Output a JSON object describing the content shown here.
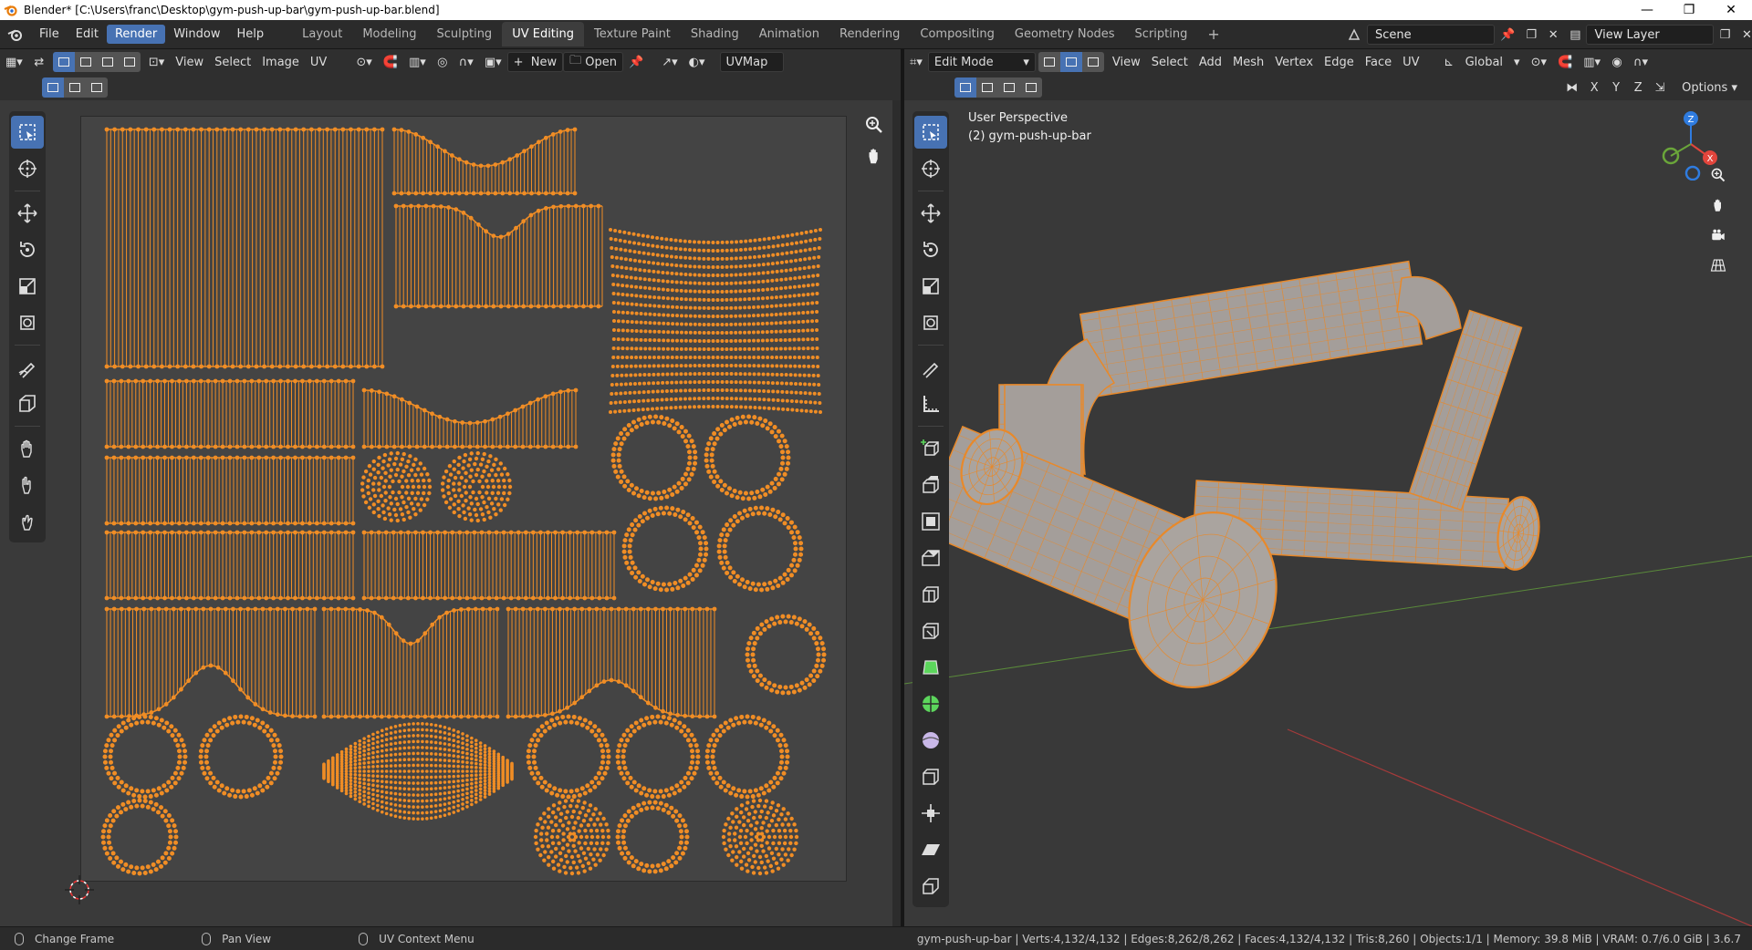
{
  "window": {
    "title": "Blender* [C:\\Users\\franc\\Desktop\\gym-push-up-bar\\gym-push-up-bar.blend]",
    "controls": [
      "—",
      "❐",
      "✕"
    ]
  },
  "menu": {
    "items": [
      "File",
      "Edit",
      "Render",
      "Window",
      "Help"
    ],
    "active": "Render"
  },
  "workspaces": {
    "tabs": [
      "Layout",
      "Modeling",
      "Sculpting",
      "UV Editing",
      "Texture Paint",
      "Shading",
      "Animation",
      "Rendering",
      "Compositing",
      "Geometry Nodes",
      "Scripting"
    ],
    "active": "UV Editing",
    "add_symbol": "+"
  },
  "scene": {
    "label": "Scene",
    "view_layer": "View Layer"
  },
  "uv_editor": {
    "menus": [
      "View",
      "Select",
      "Image",
      "UV"
    ],
    "new_label": "New",
    "open_label": "Open",
    "uvmap_label": "UVMap"
  },
  "viewport": {
    "mode": "Edit Mode",
    "menus": [
      "View",
      "Select",
      "Add",
      "Mesh",
      "Vertex",
      "Edge",
      "Face",
      "UV"
    ],
    "orientation": "Global",
    "axes": [
      "X",
      "Y",
      "Z"
    ],
    "options_label": "Options",
    "overlay_line1": "User Perspective",
    "overlay_line2": "(2) gym-push-up-bar",
    "gizmo": {
      "z_label": "Z",
      "x_label": "X",
      "colors": {
        "x": "#e2453c",
        "y": "#6aa53a",
        "z": "#2f7ce0"
      }
    }
  },
  "status": {
    "hints": [
      "Change Frame",
      "Pan View",
      "UV Context Menu"
    ],
    "stats": "gym-push-up-bar | Verts:4,132/4,132 | Edges:8,262/8,262 | Faces:4,132/4,132 | Tris:8,260 | Objects:1/1 | Memory: 39.8 MiB | VRAM: 0.7/6.0 GiB | 3.6.7"
  },
  "colors": {
    "accent": "#4772b3",
    "uv_orange": "#f08d25",
    "mesh_wire": "#e8892a",
    "mesh_fill": "#a49e9a"
  }
}
